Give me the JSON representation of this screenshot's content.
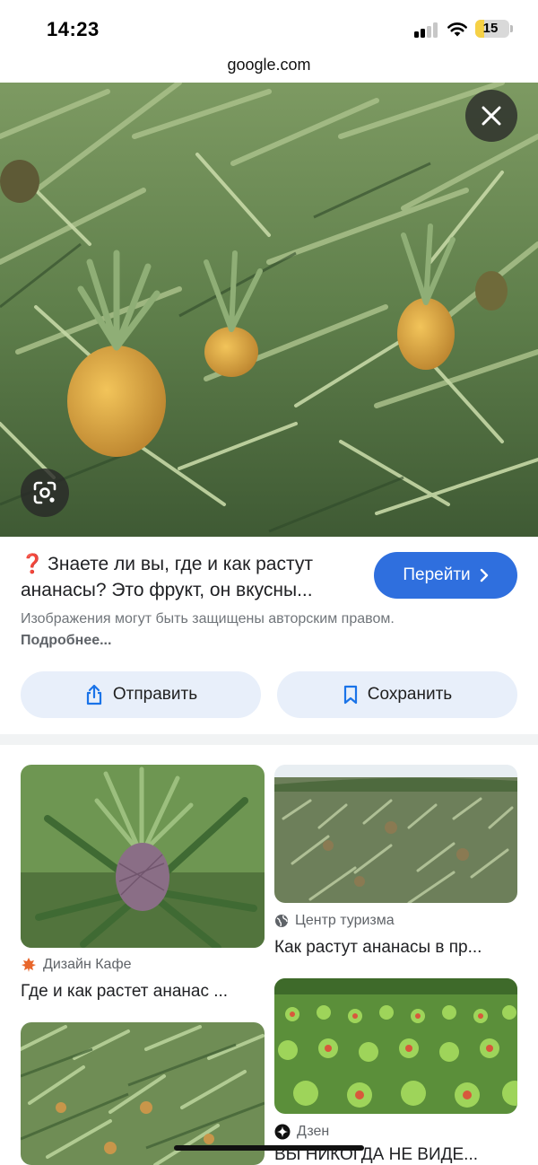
{
  "status_bar": {
    "time": "14:23",
    "battery_level": "15",
    "battery_fraction": 0.15
  },
  "browser": {
    "url": "google.com"
  },
  "viewer": {
    "icons": {
      "close": "close-icon",
      "lens": "google-lens-icon"
    },
    "title_emoji": "❓",
    "title_line1": "Знаете ли вы, где и как растут",
    "title_line2": "ананасы? Это фрукт, он вкусны...",
    "visit_label": "Перейти",
    "copyright_text": "Изображения могут быть защищены авторским правом.",
    "copyright_link": "Подробнее...",
    "share_label": "Отправить",
    "save_label": "Сохранить"
  },
  "related": [
    {
      "source": "Дизайн Кафе",
      "source_icon": "maple-leaf-icon",
      "title": "Где и как растет ананас ..."
    },
    {
      "source": "Центр туризма",
      "source_icon": "globe-icon",
      "title": "Как растут ананасы в пр..."
    },
    {
      "source": "",
      "source_icon": "",
      "title": ""
    },
    {
      "source": "Дзен",
      "source_icon": "dzen-icon",
      "title": "ВЫ НИКОГДА НЕ ВИДЕ..."
    }
  ],
  "colors": {
    "accent": "#2f6fde",
    "chip_bg": "#e8effa",
    "muted": "#70757a"
  }
}
